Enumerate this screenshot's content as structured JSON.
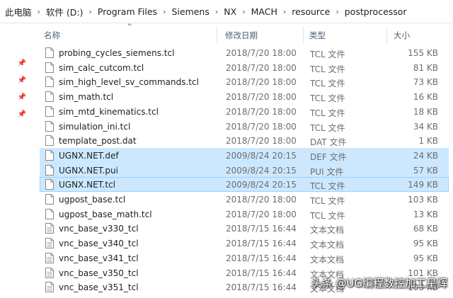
{
  "breadcrumb": [
    "此电脑",
    "软件 (D:)",
    "Program Files",
    "Siemens",
    "NX",
    "MACH",
    "resource",
    "postprocessor"
  ],
  "columns": {
    "name": "名称",
    "date": "修改日期",
    "type": "类型",
    "size": "大小"
  },
  "files": [
    {
      "name": "probing_cycles_siemens.tcl",
      "date": "2018/7/20 18:00",
      "type": "TCL 文件",
      "size": "155 KB",
      "icon": "tcl-file-icon",
      "selected": false
    },
    {
      "name": "sim_calc_cutcom.tcl",
      "date": "2018/7/20 18:00",
      "type": "TCL 文件",
      "size": "81 KB",
      "icon": "tcl-file-icon",
      "selected": false
    },
    {
      "name": "sim_high_level_sv_commands.tcl",
      "date": "2018/7/20 18:00",
      "type": "TCL 文件",
      "size": "73 KB",
      "icon": "tcl-file-icon",
      "selected": false
    },
    {
      "name": "sim_math.tcl",
      "date": "2018/7/20 18:00",
      "type": "TCL 文件",
      "size": "16 KB",
      "icon": "tcl-file-icon",
      "selected": false
    },
    {
      "name": "sim_mtd_kinematics.tcl",
      "date": "2018/7/20 18:00",
      "type": "TCL 文件",
      "size": "18 KB",
      "icon": "tcl-file-icon",
      "selected": false
    },
    {
      "name": "simulation_ini.tcl",
      "date": "2018/7/20 18:00",
      "type": "TCL 文件",
      "size": "34 KB",
      "icon": "tcl-file-icon",
      "selected": false
    },
    {
      "name": "template_post.dat",
      "date": "2018/7/20 18:00",
      "type": "DAT 文件",
      "size": "1 KB",
      "icon": "dat-file-icon",
      "selected": false
    },
    {
      "name": "UGNX.NET.def",
      "date": "2009/8/24 20:15",
      "type": "DEF 文件",
      "size": "24 KB",
      "icon": "def-file-icon",
      "selected": true
    },
    {
      "name": "UGNX.NET.pui",
      "date": "2009/8/24 20:15",
      "type": "PUI 文件",
      "size": "57 KB",
      "icon": "pui-file-icon",
      "selected": true
    },
    {
      "name": "UGNX.NET.tcl",
      "date": "2009/8/24 20:15",
      "type": "TCL 文件",
      "size": "149 KB",
      "icon": "tcl-file-icon",
      "selected": true,
      "focused": true
    },
    {
      "name": "ugpost_base.tcl",
      "date": "2018/7/20 18:00",
      "type": "TCL 文件",
      "size": "103 KB",
      "icon": "tcl-file-icon",
      "selected": false
    },
    {
      "name": "ugpost_base_math.tcl",
      "date": "2018/7/20 18:00",
      "type": "TCL 文件",
      "size": "13 KB",
      "icon": "tcl-file-icon",
      "selected": false
    },
    {
      "name": "vnc_base_v330_tcl",
      "date": "2018/7/15 16:44",
      "type": "文本文档",
      "size": "68 KB",
      "icon": "text-document-icon",
      "selected": false
    },
    {
      "name": "vnc_base_v340_tcl",
      "date": "2018/7/15 16:44",
      "type": "文本文档",
      "size": "95 KB",
      "icon": "text-document-icon",
      "selected": false
    },
    {
      "name": "vnc_base_v341_tcl",
      "date": "2018/7/15 16:44",
      "type": "文本文档",
      "size": "95 KB",
      "icon": "text-document-icon",
      "selected": false
    },
    {
      "name": "vnc_base_v350_tcl",
      "date": "2018/7/15 16:44",
      "type": "文本文档",
      "size": "101 KB",
      "icon": "text-document-icon",
      "selected": false
    },
    {
      "name": "vnc_base_v351_tcl",
      "date": "2018/7/15 16:44",
      "type": "文本文档",
      "size": "103 KB",
      "icon": "text-document-icon",
      "selected": false
    }
  ],
  "quick_access_pins": [
    "pin-icon",
    "pin-icon",
    "pin-icon",
    "pin-icon"
  ],
  "watermark": "头条 @UG编程数控加工星辉",
  "colors": {
    "selection": "#cce8ff",
    "focus_border": "#99d1ff",
    "header_text": "#4c607a"
  }
}
